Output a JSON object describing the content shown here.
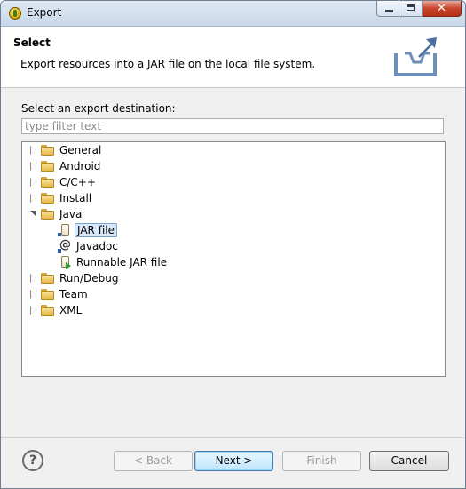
{
  "window": {
    "title": "Export",
    "close_glyph": "✕"
  },
  "header": {
    "title": "Select",
    "description": "Export resources into a JAR file on the local file system."
  },
  "filter": {
    "label": "Select an export destination:",
    "placeholder": "type filter text",
    "value": ""
  },
  "tree": {
    "items": [
      {
        "label": "General"
      },
      {
        "label": "Android"
      },
      {
        "label": "C/C++"
      },
      {
        "label": "Install"
      },
      {
        "label": "Java",
        "children": [
          {
            "label": "JAR file",
            "selected": true
          },
          {
            "label": "Javadoc"
          },
          {
            "label": "Runnable JAR file"
          }
        ]
      },
      {
        "label": "Run/Debug"
      },
      {
        "label": "Team"
      },
      {
        "label": "XML"
      }
    ]
  },
  "buttons": {
    "help": "?",
    "back": "< Back",
    "next": "Next >",
    "finish": "Finish",
    "cancel": "Cancel"
  },
  "colors": {
    "accent": "#3c7fb1",
    "selection": "#d9e8fb"
  }
}
